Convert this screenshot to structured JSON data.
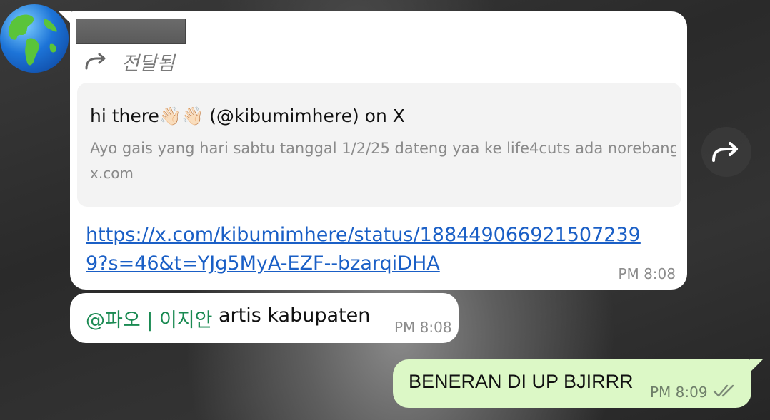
{
  "forwarded_message": {
    "forward_label": "전달됨",
    "preview": {
      "title": "hi there👋🏻👋🏻 (@kibumimhere) on X",
      "description": "Ayo gais yang hari sabtu tanggal 1/2/25 dateng yaa ke life4cuts ada norebang...",
      "domain": "x.com"
    },
    "link": "https://x.com/kibumimhere/status/1884490669215072399?s=46&t=YJg5MyA-EZF--bzarqiDHA",
    "time": "PM 8:08"
  },
  "reply_message": {
    "mention": "@파오 | 이지안",
    "text": "artis kabupaten",
    "time": "PM 8:08"
  },
  "outgoing_message": {
    "text": "BENERAN DI UP BJIRRR",
    "time": "PM 8:09",
    "status": "read"
  },
  "icons": {
    "avatar": "globe-americas-icon",
    "forward": "forward-arrow-icon",
    "share": "share-forward-icon",
    "ticks": "double-check-icon"
  },
  "colors": {
    "link": "#1a5fc6",
    "mention": "#1a8a52",
    "outgoing_bubble": "#dcf8c6"
  }
}
